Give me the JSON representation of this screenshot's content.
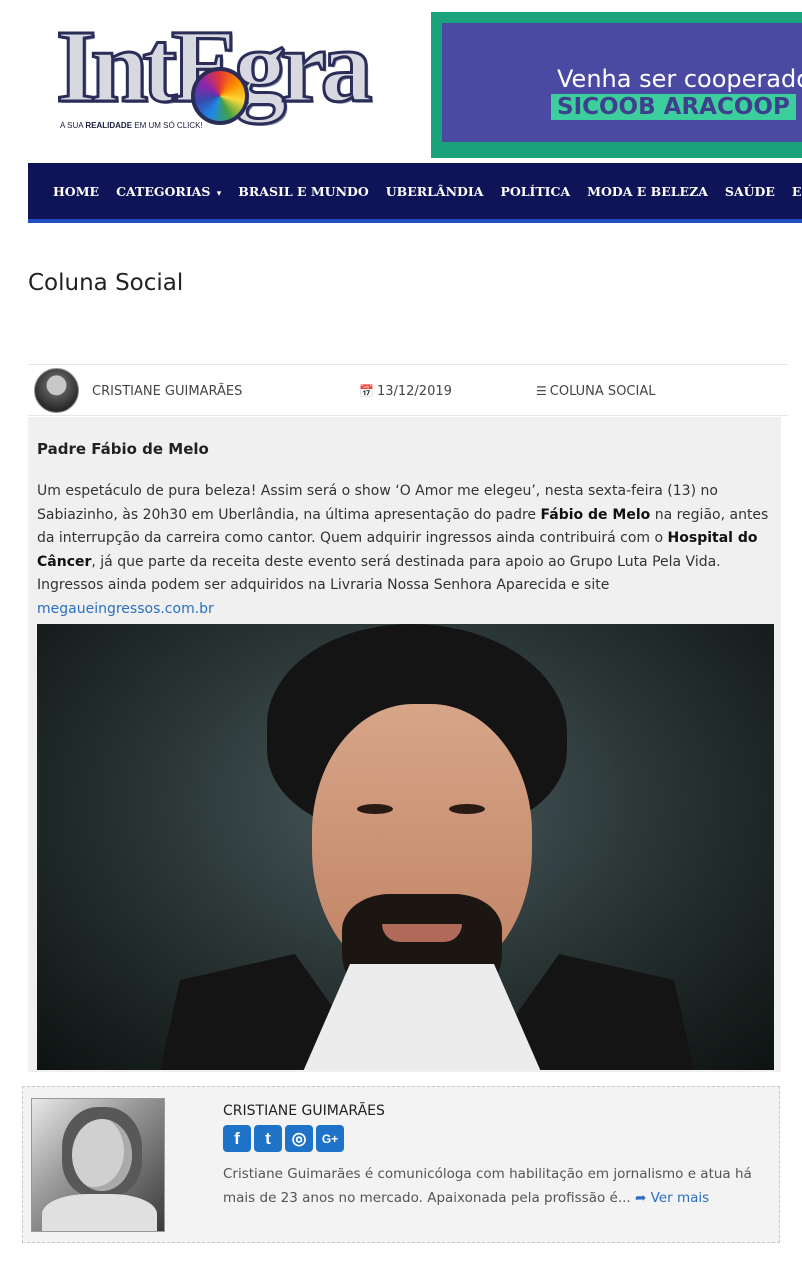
{
  "header": {
    "logo": {
      "wordmark": "IntEgra",
      "tagline_pre": "A SUA ",
      "tagline_bold": "REALIDADE",
      "tagline_post": " EM UM SÓ CLICK!"
    },
    "banner": {
      "line1": "Venha ser cooperado",
      "line2": "SICOOB ARACOOP",
      "colors": {
        "frame": "#1aa37a",
        "panel": "#4b4aa3",
        "highlight": "#3ccf9d"
      }
    }
  },
  "nav": {
    "items": [
      {
        "label": "HOME"
      },
      {
        "label": "CATEGORIAS",
        "has_dropdown": true
      },
      {
        "label": "BRASIL E MUNDO"
      },
      {
        "label": "UBERLÂNDIA"
      },
      {
        "label": "POLÍTICA"
      },
      {
        "label": "MODA E BELEZA"
      },
      {
        "label": "SAÚDE"
      },
      {
        "label": "ESPORTE"
      }
    ],
    "caret": "▾",
    "colors": {
      "background": "#0f1458",
      "underline": "#1f4fc2"
    }
  },
  "page": {
    "title": "Coluna Social"
  },
  "meta": {
    "author": "CRISTIANE GUIMARÃES",
    "date": "13/12/2019",
    "category": "COLUNA SOCIAL",
    "icons": {
      "date": "calendar-icon",
      "category": "list-icon"
    }
  },
  "article": {
    "title": "Padre Fábio de Melo",
    "body": {
      "p1": "Um espetáculo de pura beleza! Assim será o show ‘O Amor me elegeu’, nesta sexta-feira (13) no Sabiazinho, às 20h30 em Uberlândia, na última apresentação do padre ",
      "b1": "Fábio de Melo",
      "p2": " na região, antes da interrupção da carreira como cantor. Quem adquirir ingressos ainda contribuirá com o ",
      "b2": "Hospital do Câncer",
      "p3": ", já que parte da receita deste evento será destinada para apoio ao Grupo Luta Pela Vida. Ingressos ainda podem ser adquiridos na Livraria Nossa Senhora Aparecida e site ",
      "link": "megaueingressos.com.br"
    }
  },
  "author_box": {
    "name": "CRISTIANE GUIMARÃES",
    "social": [
      {
        "icon": "facebook-icon",
        "glyph": "f"
      },
      {
        "icon": "twitter-icon",
        "glyph": "t"
      },
      {
        "icon": "instagram-icon",
        "glyph": "◎"
      },
      {
        "icon": "google-plus-icon",
        "glyph": "G+"
      }
    ],
    "bio": "Cristiane Guimarães é comunicóloga com habilitação em jornalismo e atua há mais de 23 anos no mercado. Apaixonada pela profissão é... ",
    "more_icon": "share-arrow-icon",
    "more_label": "Ver mais",
    "accent": "#1e73c8"
  }
}
